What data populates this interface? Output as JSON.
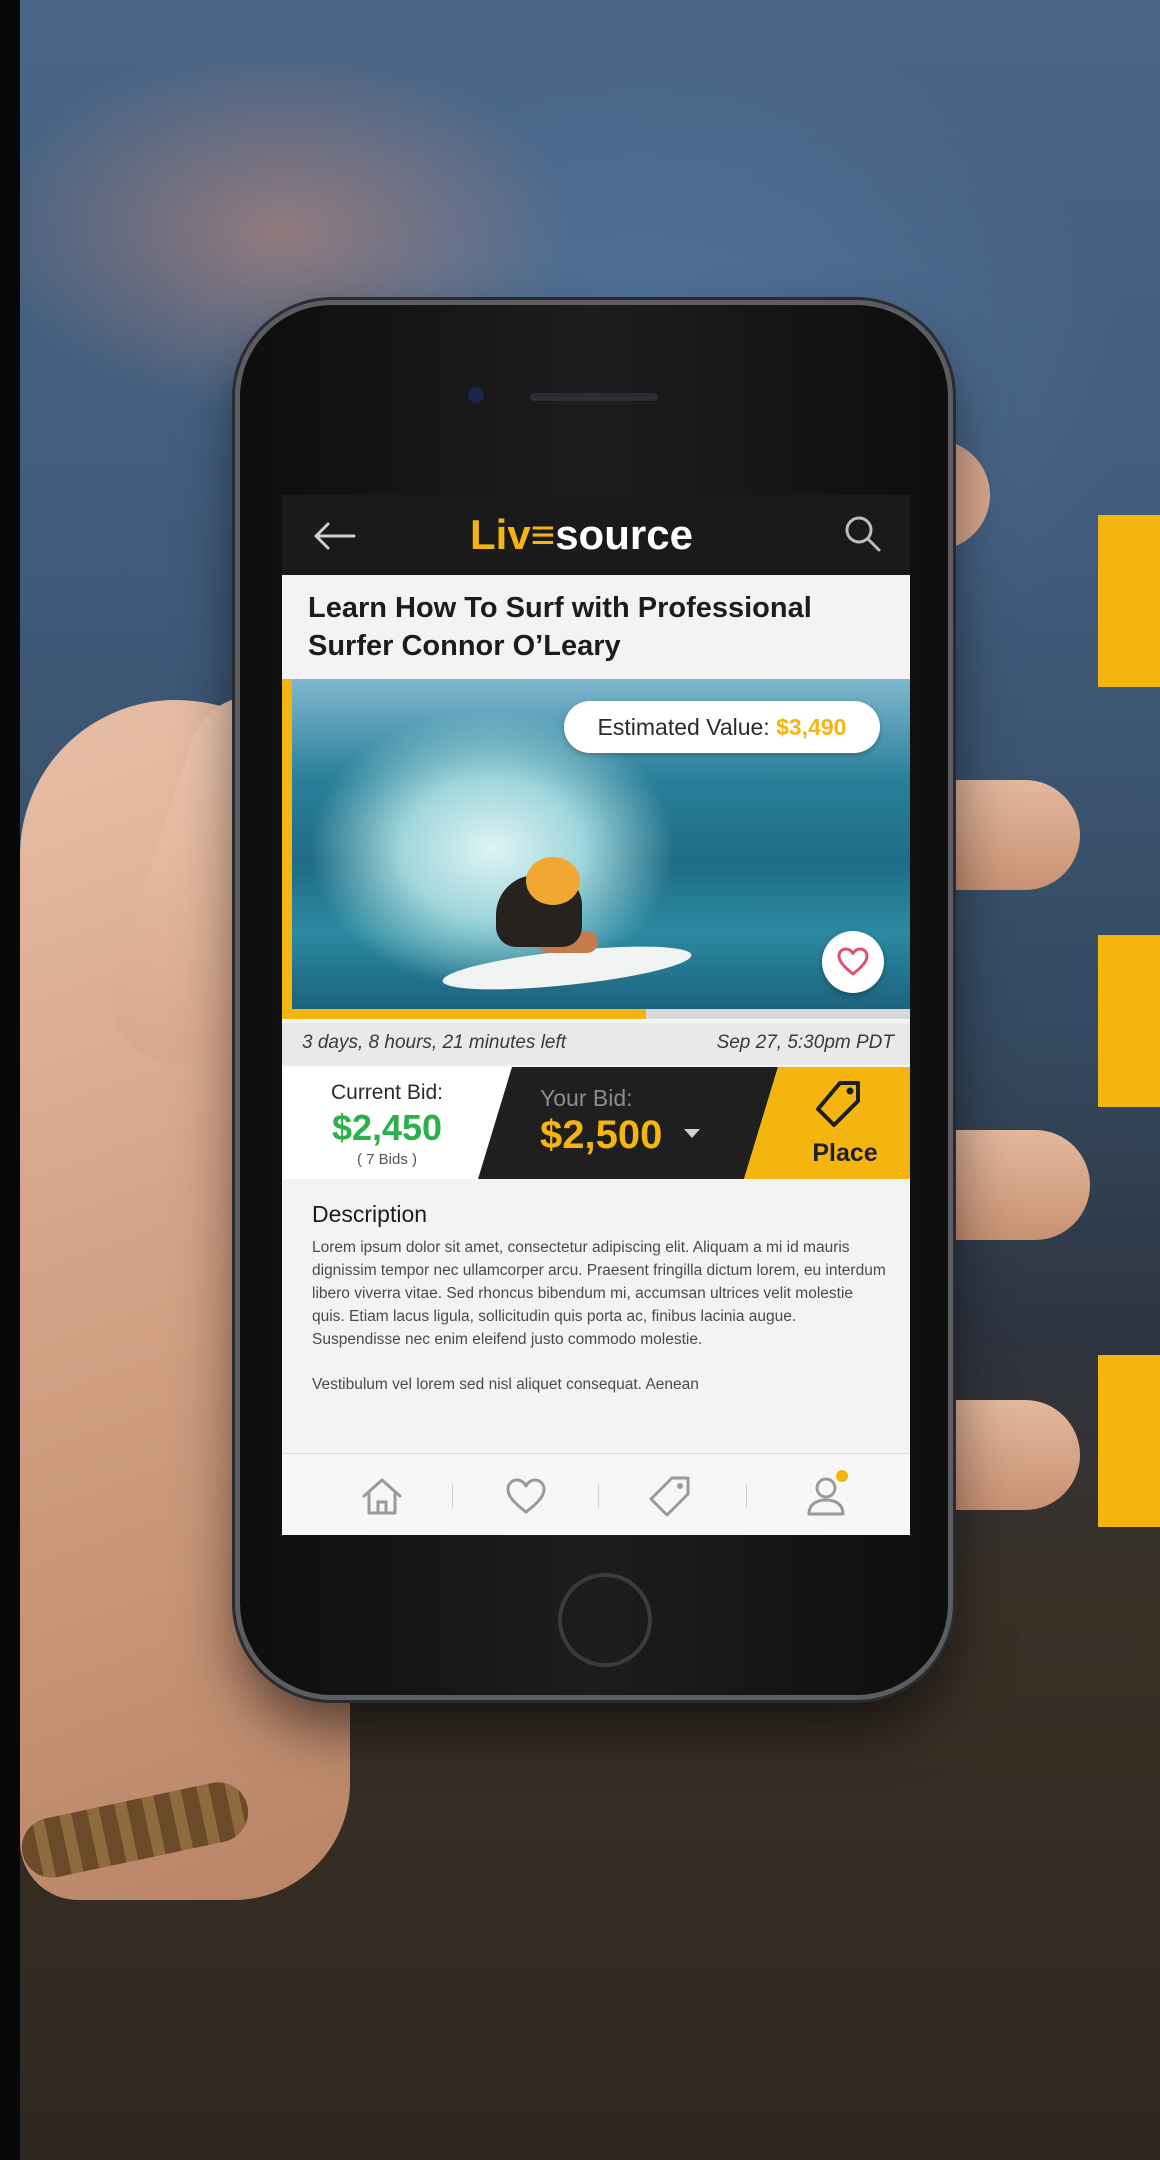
{
  "app": {
    "logo_part1": "Liv≡",
    "logo_part2": "source"
  },
  "listing": {
    "title": "Learn How To Surf with Professional Surfer Connor O’Leary",
    "estimated_value_label": "Estimated Value:",
    "estimated_value": "$3,490",
    "time_left": "3 days, 8 hours, 21 minutes left",
    "end_date": "Sep 27, 5:30pm PDT",
    "elapsed_fraction": 0.58
  },
  "bid": {
    "current_label": "Current Bid:",
    "current_value": "$2,450",
    "bid_count": "( 7 Bids )",
    "your_label": "Your Bid:",
    "your_value": "$2,500",
    "place_label": "Place"
  },
  "description": {
    "heading": "Description",
    "paragraph1": "Lorem ipsum dolor sit amet, consectetur adipiscing elit. Aliquam a mi id mauris dignissim tempor nec ullamcorper arcu. Praesent fringilla dictum lorem, eu interdum libero viverra vitae. Sed rhoncus bibendum mi, accumsan ultrices velit molestie quis. Etiam lacus ligula, sollicitudin quis porta ac, finibus lacinia augue. Suspendisse nec enim eleifend justo commodo molestie.",
    "paragraph2": "Vestibulum vel lorem sed nisl aliquet consequat. Aenean"
  },
  "nav": {
    "items": [
      "home-icon",
      "heart-icon",
      "tag-icon",
      "user-icon"
    ]
  },
  "colors": {
    "brand_yellow": "#f5b50f",
    "bid_green": "#2bb14a",
    "header_dark": "#1a1a1a"
  }
}
